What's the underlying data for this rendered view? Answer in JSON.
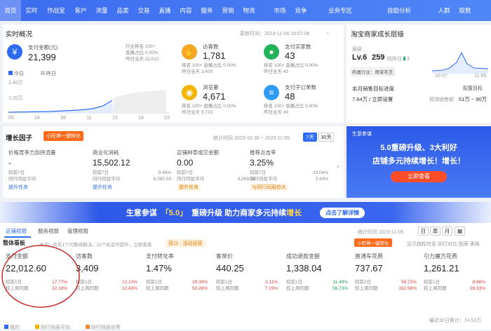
{
  "nav": [
    "首页",
    "实时",
    "作战室",
    "客户",
    "流量",
    "品类",
    "交易",
    "直播",
    "内容",
    "服务",
    "营销",
    "物流",
    "市场",
    "竞争",
    "业务专区",
    "自助分析",
    "人群",
    "取数"
  ],
  "realtime": {
    "title": "实时概况",
    "updated": "更新时间：2023-11-06 16:57:06",
    "pay_label": "支付金额(元)",
    "pay_value": "21,399",
    "industry_rank": "行业排名",
    "rank_value": "100+",
    "prev_day_label": "直播占比",
    "prev_day_value": "0.00%",
    "yesterday_label": "昨日全天",
    "yesterday_value": "22,012",
    "legend_today": "今日",
    "legend_yesterday": "昨日",
    "axis_top": "2.40万",
    "axis_mid": "1.20万",
    "axis_ticks": [
      "00",
      "04",
      "08",
      "11",
      "15",
      "18",
      "23"
    ],
    "cards": [
      {
        "label": "访客数",
        "value": "1,781",
        "rank": "100+",
        "a": "0.00%",
        "b": "3,409",
        "icon": "hand-icon"
      },
      {
        "label": "支付买家数",
        "value": "43",
        "rank": "100+",
        "a": "0.00%",
        "b": "43",
        "icon": "user-icon"
      },
      {
        "label": "浏览量",
        "value": "4,671",
        "rank": "100+",
        "a": "0.00%",
        "b": "9,720",
        "icon": "eye-icon"
      },
      {
        "label": "支付子订单数",
        "value": "48",
        "rank": "100+",
        "a": "0.00%",
        "b": "49",
        "icon": "order-icon"
      }
    ],
    "card_rank_label": "排名",
    "card_a_label": "直播占比",
    "card_b_label": "昨日全天"
  },
  "growth": {
    "title": "淘宝商家成长层级",
    "level_label": "层级",
    "level": "Lv.6",
    "score": "259",
    "score_note": "较昨日",
    "score_change": "3",
    "industry": "所属行业：居家布艺",
    "target": "本月销售目标进度",
    "config": "配置目标",
    "amount": "7.64万 / 立即设置",
    "forecast": "预测销售额",
    "forecast_range": "51万 ~ 90万",
    "x_start": "10-07",
    "x_end": "11-05"
  },
  "factors": {
    "title": "增长因子",
    "tag": "小旺神一键转化",
    "date_range": "统计时间 2023-10-30 ~ 2023-11-05",
    "seven": "7天",
    "thirty": "30天",
    "items": [
      {
        "label": "价格竞争力加持流量",
        "value": "-",
        "c1": "较前7日",
        "c2": "同行同层平均",
        "p1": "",
        "p2": "",
        "link": "提升任务"
      },
      {
        "label": "商业化消耗",
        "value": "15,502.12",
        "c1": "较前7日",
        "c2": "同行同层平均",
        "p1": "9.46%",
        "p2": "6,080.59",
        "link": "提升任务"
      },
      {
        "label": "店铺种草成交金额",
        "value": "0.00",
        "c1": "较前7日",
        "c2": "同行同层平均",
        "p1": "",
        "p2": "4,269.34",
        "link": "提升任务"
      },
      {
        "label": "推荐点击率",
        "value": "3.25%",
        "c1": "较前7日",
        "c2": "同行同层平均",
        "p1": "33.04%",
        "p2": "3.43%",
        "link": "与同行同层较大"
      }
    ]
  },
  "ad": {
    "brand": "生意参谋",
    "line1": "5.0重磅升级、3大利好",
    "line2": "店铺多元持续增长！增长！",
    "button": "立即查看"
  },
  "banner": {
    "text1": "生意参谋",
    "badge": "「5.0」",
    "text2": "重磅升级  助力商家多元持续",
    "text3": "增长",
    "button": "点击了解详情"
  },
  "tabs": [
    "店铺视窗",
    "服务视窗",
    "管理视窗"
  ],
  "stat_date": "统计时间 2023-11-05",
  "period_buttons": [
    "日",
    "周",
    "月"
  ],
  "overview": {
    "title": "整体看板",
    "note": "本次：共有1个问题待解决，22个机会可提升，立即查看",
    "event": "双11 · 活动运营",
    "tag": "小旺神一键转化",
    "opt1": "显示指标信息",
    "opt2": "同行对比",
    "opt3": "图表",
    "opt4": "表格"
  },
  "kpis": [
    {
      "label": "支付金额",
      "value": "22,012.60",
      "c1": "较前1日",
      "c2": "较上周同期",
      "p1": "17.77%",
      "p2": "22.18%"
    },
    {
      "label": "访客数",
      "value": "3,409",
      "c1": "较前1日",
      "c2": "较上周同期",
      "p1": "12.13%",
      "p2": "12.43%"
    },
    {
      "label": "支付转化率",
      "value": "1.47%",
      "c1": "较前1日",
      "c2": "较上周同期",
      "p1": "29.30%",
      "p2": "50.26%"
    },
    {
      "label": "客单价",
      "value": "440.25",
      "c1": "较前1日",
      "c2": "较上周同期",
      "p1": "3.11%",
      "p2": "7.15%"
    },
    {
      "label": "成功退款金额",
      "value": "1,338.04",
      "c1": "较前1日",
      "c2": "较上周同期",
      "p1": "11.49%",
      "p2": "56.73%"
    },
    {
      "label": "直通车花费",
      "value": "737.67",
      "c1": "较前1日",
      "c2": "较上周同期",
      "p1": "58.72%",
      "p2": "152.56%"
    },
    {
      "label": "引力魔方花费",
      "value": "1,261.21",
      "c1": "较前1日",
      "c2": "较上周同期",
      "p1": "8.86%",
      "p2": "28.33%"
    }
  ],
  "footer": {
    "recent": "最近30日累计：74.53万",
    "legend": [
      "我的",
      "同行同层平均",
      "同行同层优秀"
    ]
  },
  "colors": {
    "nav": "#3d6cf0",
    "accent": "#ff6a1a",
    "up": "#e23c3c",
    "down": "#17a35a",
    "circle": "#c72a2a"
  }
}
